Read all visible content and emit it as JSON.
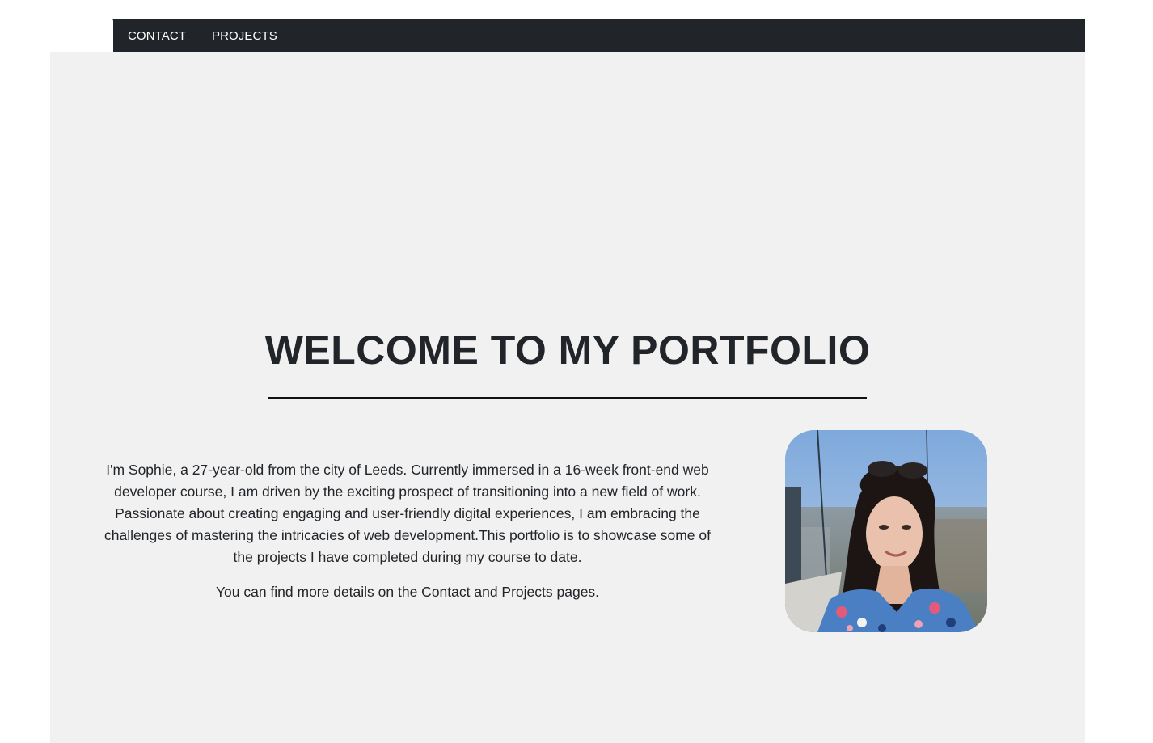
{
  "nav": {
    "contact_label": "CONTACT",
    "projects_label": "PROJECTS"
  },
  "hero": {
    "title": "WELCOME TO MY PORTFOLIO"
  },
  "intro": {
    "paragraph_1": "I'm Sophie, a 27-year-old from the city of Leeds. Currently immersed in a 16-week front-end web developer course, I am driven by the exciting prospect of transitioning into a new field of work. Passionate about creating engaging and user-friendly digital experiences, I am embracing the challenges of mastering the intricacies of web development.This portfolio is to showcase some of the projects I have completed during my course to date.",
    "paragraph_2": "You can find more details on the Contact and Projects pages."
  },
  "profile_photo": {
    "icon": "profile-photo"
  }
}
